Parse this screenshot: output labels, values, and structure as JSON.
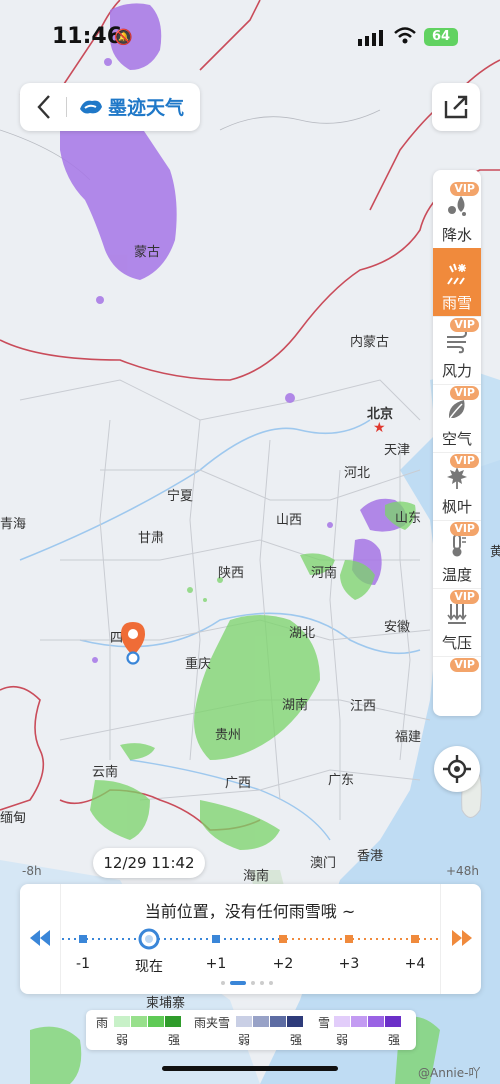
{
  "status_bar": {
    "time": "11:46",
    "battery": "64"
  },
  "header": {
    "back_label": "",
    "brand": "墨迹天气"
  },
  "map_labels": {
    "mongolia": "蒙古",
    "inner_mongolia": "内蒙古",
    "beijing": "北京",
    "tianjin": "天津",
    "hebei": "河北",
    "ningxia": "宁夏",
    "qinghai": "青海",
    "gansu": "甘肃",
    "shanxi": "山西",
    "shandong": "山东",
    "shaanxi": "陕西",
    "henan": "河南",
    "sichuan": "四",
    "hubei": "湖北",
    "anhui": "安徽",
    "chongqing": "重庆",
    "hunan": "湖南",
    "jiangxi": "江西",
    "guizhou": "贵州",
    "fujian": "福建",
    "yunnan": "云南",
    "guangxi": "广西",
    "guangdong": "广东",
    "myanmar": "缅甸",
    "macau": "澳门",
    "hongkong": "香港",
    "hainan": "海南",
    "cambodia": "柬埔寨",
    "gmt_left": "-8h",
    "gmt_right": "+48h",
    "huang": "黄"
  },
  "layers": [
    {
      "name": "precip",
      "label": "降水",
      "vip": "VIP",
      "icon": "raindrop-icon"
    },
    {
      "name": "rain-snow",
      "label": "雨雪",
      "vip": "",
      "icon": "rain-snow-icon",
      "active": true
    },
    {
      "name": "wind",
      "label": "风力",
      "vip": "VIP",
      "icon": "wind-icon"
    },
    {
      "name": "air",
      "label": "空气",
      "vip": "VIP",
      "icon": "leaf-icon"
    },
    {
      "name": "foliage",
      "label": "枫叶",
      "vip": "VIP",
      "icon": "maple-leaf-icon"
    },
    {
      "name": "temp",
      "label": "温度",
      "vip": "VIP",
      "icon": "thermometer-icon"
    },
    {
      "name": "pressure",
      "label": "气压",
      "vip": "VIP",
      "icon": "pressure-icon"
    },
    {
      "name": "more",
      "label": "",
      "vip": "VIP",
      "icon": "more-icon"
    }
  ],
  "timeline": {
    "current_time": "12/29 11:42",
    "message": "当前位置，没有任何雨雪哦 ~",
    "ticks": [
      "-1",
      "现在",
      "+1",
      "+2",
      "+3",
      "+4"
    ]
  },
  "legend": {
    "rain": "雨",
    "sleet": "雨夹雪",
    "snow": "雪",
    "weak": "弱",
    "strong": "强",
    "colors": {
      "rain": [
        "#c8f1c8",
        "#98e08c",
        "#5fca56",
        "#2f9c2b"
      ],
      "sleet": [
        "#c9cfe5",
        "#98a2c7",
        "#5d6ca3",
        "#2e3b7a"
      ],
      "snow": [
        "#e2cdfa",
        "#c39bf2",
        "#9a63e4",
        "#6b2fc8"
      ]
    }
  },
  "watermark": "@Annie-吖",
  "colors": {
    "accent": "#f08a3c",
    "brand": "#1f78c8",
    "timeline_past": "#3a86d8",
    "timeline_future": "#f08a3c"
  }
}
